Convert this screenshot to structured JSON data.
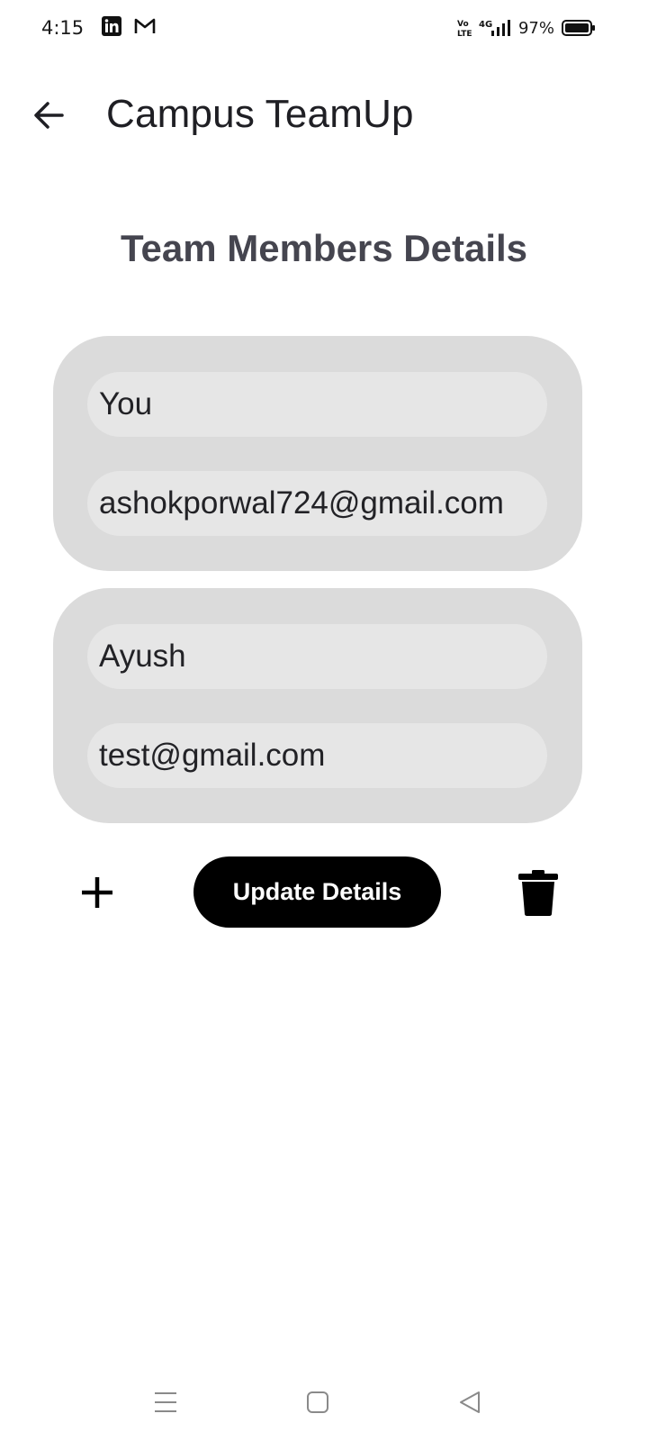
{
  "status_bar": {
    "time": "4:15",
    "notification_icons": [
      "linkedin-icon",
      "gmail-icon"
    ],
    "network_label": "VoLTE 4G",
    "battery": "97%",
    "battery_level": 0.97
  },
  "app_bar": {
    "title": "Campus TeamUp",
    "back_icon": "arrow-left-icon"
  },
  "page": {
    "heading": "Team Members Details"
  },
  "members": [
    {
      "name": "You",
      "email": "ashokporwal724@gmail.com"
    },
    {
      "name": "Ayush",
      "email": "test@gmail.com"
    }
  ],
  "actions": {
    "add_icon": "plus-icon",
    "update_label": "Update Details",
    "delete_icon": "trash-icon"
  },
  "navigation_bar": {
    "buttons": [
      "menu-icon",
      "home-icon",
      "back-icon"
    ]
  },
  "colors": {
    "card_background": "#dbdbdb",
    "field_background": "#e6e6e6",
    "primary_button": "#000000",
    "heading_text": "#45454f"
  }
}
